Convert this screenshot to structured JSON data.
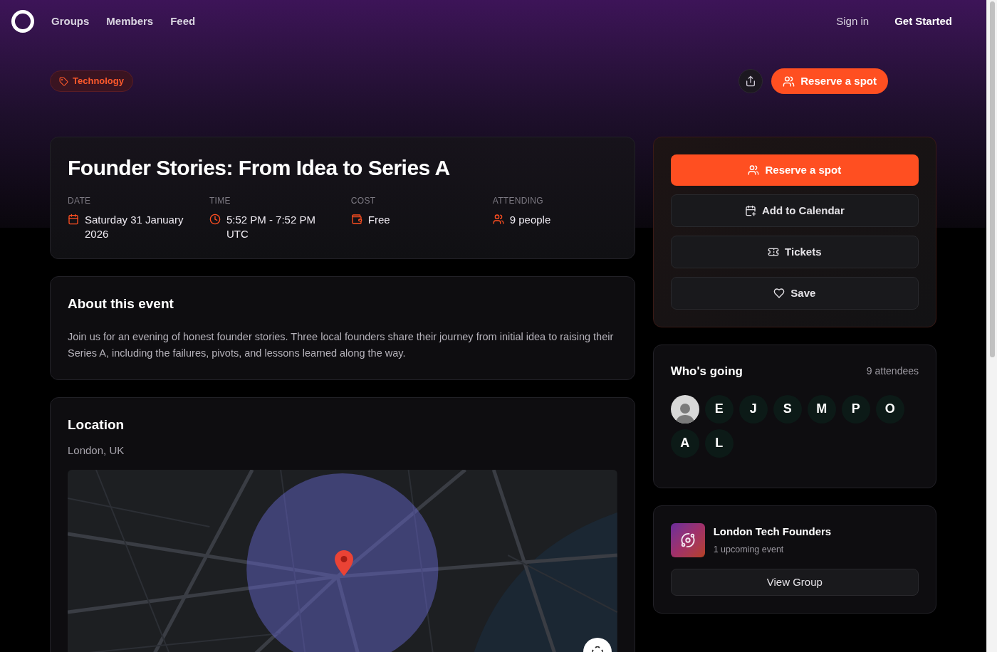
{
  "nav": {
    "links": [
      "Groups",
      "Members",
      "Feed"
    ],
    "sign_in": "Sign in",
    "get_started": "Get Started"
  },
  "category": "Technology",
  "header_action": "Reserve a spot",
  "event": {
    "title": "Founder Stories: From Idea to Series A",
    "details": [
      {
        "kind": "date",
        "label": "DATE",
        "value": "Saturday 31 January 2026"
      },
      {
        "kind": "time",
        "label": "TIME",
        "value": "5:52 PM - 7:52 PM UTC"
      },
      {
        "kind": "cost",
        "label": "COST",
        "value": "Free"
      },
      {
        "kind": "attending",
        "label": "ATTENDING",
        "value": "9 people"
      }
    ]
  },
  "about": {
    "title": "About this event",
    "text": "Join us for an evening of honest founder stories. Three local founders share their journey from initial idea to raising their Series A, including the failures, pivots, and lessons learned along the way."
  },
  "location": {
    "title": "Location",
    "place": "London, UK"
  },
  "actions": [
    {
      "kind": "primary",
      "label": "Reserve a spot"
    },
    {
      "kind": "calendar",
      "label": "Add to Calendar"
    },
    {
      "kind": "tickets",
      "label": "Tickets"
    },
    {
      "kind": "save",
      "label": "Save"
    }
  ],
  "attendees": {
    "title": "Who's going",
    "count": "9 attendees",
    "people": [
      {
        "kind": "photo"
      },
      {
        "kind": "initial",
        "initial": "E"
      },
      {
        "kind": "initial",
        "initial": "J"
      },
      {
        "kind": "initial",
        "initial": "S"
      },
      {
        "kind": "initial",
        "initial": "M"
      },
      {
        "kind": "initial",
        "initial": "P"
      },
      {
        "kind": "initial",
        "initial": "O"
      },
      {
        "kind": "initial",
        "initial": "A"
      },
      {
        "kind": "initial",
        "initial": "L"
      }
    ]
  },
  "group": {
    "name": "London Tech Founders",
    "subtitle": "1 upcoming event",
    "button": "View Group"
  }
}
